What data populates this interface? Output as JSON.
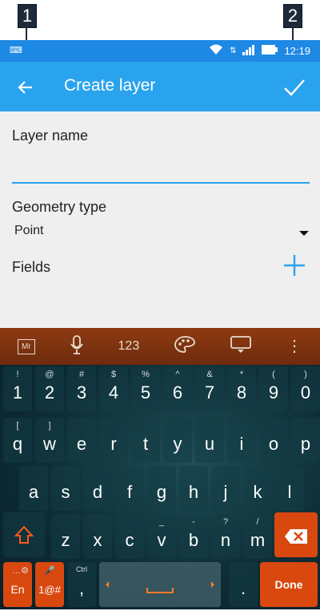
{
  "markers": {
    "one": "1",
    "two": "2"
  },
  "status_bar": {
    "left_icon": "keyboard-icon",
    "time": "12:19"
  },
  "app_bar": {
    "title": "Create layer"
  },
  "form": {
    "layer_name_label": "Layer name",
    "geometry_type_label": "Geometry type",
    "geometry_type_value": "Point",
    "fields_label": "Fields"
  },
  "keyboard": {
    "toolbar": {
      "numbers_label": "123"
    },
    "row1": [
      {
        "m": "1",
        "s": "!"
      },
      {
        "m": "2",
        "s": "@"
      },
      {
        "m": "3",
        "s": "#"
      },
      {
        "m": "4",
        "s": "$"
      },
      {
        "m": "5",
        "s": "%"
      },
      {
        "m": "6",
        "s": "^"
      },
      {
        "m": "7",
        "s": "&"
      },
      {
        "m": "8",
        "s": "*"
      },
      {
        "m": "9",
        "s": "("
      },
      {
        "m": "0",
        "s": ")"
      }
    ],
    "row2": [
      {
        "m": "q",
        "s": "["
      },
      {
        "m": "w",
        "s": "]"
      },
      {
        "m": "e",
        "s": ""
      },
      {
        "m": "r",
        "s": ""
      },
      {
        "m": "t",
        "s": ""
      },
      {
        "m": "y",
        "s": ""
      },
      {
        "m": "u",
        "s": ""
      },
      {
        "m": "i",
        "s": ""
      },
      {
        "m": "o",
        "s": ""
      },
      {
        "m": "p",
        "s": ""
      }
    ],
    "row3": [
      {
        "m": "a",
        "s": ""
      },
      {
        "m": "s",
        "s": ""
      },
      {
        "m": "d",
        "s": ""
      },
      {
        "m": "f",
        "s": ""
      },
      {
        "m": "g",
        "s": ""
      },
      {
        "m": "h",
        "s": ""
      },
      {
        "m": "j",
        "s": ""
      },
      {
        "m": "k",
        "s": ""
      },
      {
        "m": "l",
        "s": ""
      }
    ],
    "row4": [
      {
        "m": "z",
        "s": ""
      },
      {
        "m": "x",
        "s": ""
      },
      {
        "m": "c",
        "s": ""
      },
      {
        "m": "v",
        "s": "_"
      },
      {
        "m": "b",
        "s": "-"
      },
      {
        "m": "n",
        "s": "?"
      },
      {
        "m": "m",
        "s": "/"
      }
    ],
    "lang_key": "En",
    "symbols_key": "1@#",
    "comma_key": ",",
    "comma_sub": "Ctrl",
    "period_key": ".",
    "done_key": "Done"
  },
  "colors": {
    "app_bar": "#29a3ee",
    "status_bar": "#1e88e5",
    "accent": "#d9480f"
  }
}
